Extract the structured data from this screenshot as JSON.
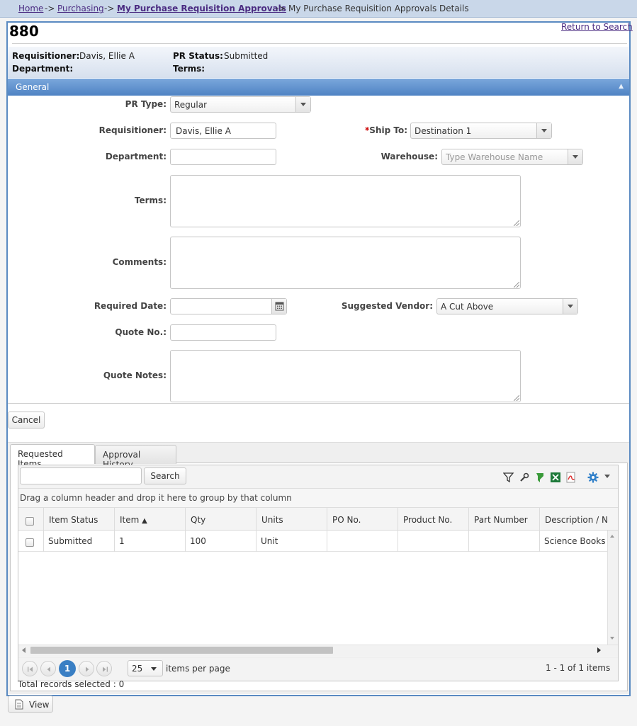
{
  "breadcrumb": {
    "home": "Home",
    "sep": "->",
    "purchasing": "Purchasing",
    "approvals": "My Purchase Requisition Approvals",
    "current": "My Purchase Requisition Approvals Details"
  },
  "header": {
    "pr_number": "880",
    "return_link": "Return to Search",
    "requisitioner_label": "Requisitioner:",
    "requisitioner_value": "Davis, Ellie A",
    "department_label": "Department:",
    "department_value": "",
    "status_label": "PR Status:",
    "status_value": "Submitted",
    "terms_label": "Terms:",
    "terms_value": ""
  },
  "section": {
    "title": "General",
    "collapse_icon": "caret-up-icon"
  },
  "form": {
    "pr_type": {
      "label": "PR Type:",
      "value": "Regular"
    },
    "requisitioner": {
      "label": "Requisitioner:",
      "value": "Davis, Ellie A"
    },
    "ship_to": {
      "required_mark": "*",
      "label": "Ship To:",
      "value": "Destination 1"
    },
    "department": {
      "label": "Department:",
      "value": ""
    },
    "warehouse": {
      "label": "Warehouse:",
      "placeholder": "Type Warehouse Name"
    },
    "terms": {
      "label": "Terms:",
      "value": ""
    },
    "comments": {
      "label": "Comments:",
      "value": ""
    },
    "required_date": {
      "label": "Required Date:",
      "value": ""
    },
    "suggested_vendor": {
      "label": "Suggested Vendor:",
      "value": "A Cut Above"
    },
    "quote_no": {
      "label": "Quote No.:",
      "value": ""
    },
    "quote_notes": {
      "label": "Quote Notes:",
      "value": ""
    }
  },
  "actions": {
    "cancel": "Cancel",
    "view": "View"
  },
  "tabs": [
    {
      "label": "Requested Items",
      "active": true
    },
    {
      "label": "Approval History",
      "active": false
    }
  ],
  "grid": {
    "search_placeholder": "",
    "search_button": "Search",
    "toolbar_icons": [
      "filter-icon",
      "wrench-icon",
      "export-green-icon",
      "excel-icon",
      "pdf-icon",
      "gear-icon"
    ],
    "group_hint": "Drag a column header and drop it here to group by that column",
    "columns": [
      "Item Status",
      "Item",
      "Qty",
      "Units",
      "PO No.",
      "Product No.",
      "Part Number",
      "Description / Na"
    ],
    "sort_indicator": "▲",
    "rows": [
      {
        "item_status": "Submitted",
        "item": "1",
        "qty": "100",
        "units": "Unit",
        "po_no": "",
        "product_no": "",
        "part_number": "",
        "description": "Science Books"
      }
    ],
    "pager": {
      "current_page": "1",
      "page_size": "25",
      "page_size_label": "items per page",
      "summary": "1 - 1 of 1 items"
    },
    "total_selected": "Total records selected : 0"
  },
  "colors": {
    "accent": "#4f83c4",
    "link": "#4b2c82",
    "page_active": "#3a7fc4"
  }
}
